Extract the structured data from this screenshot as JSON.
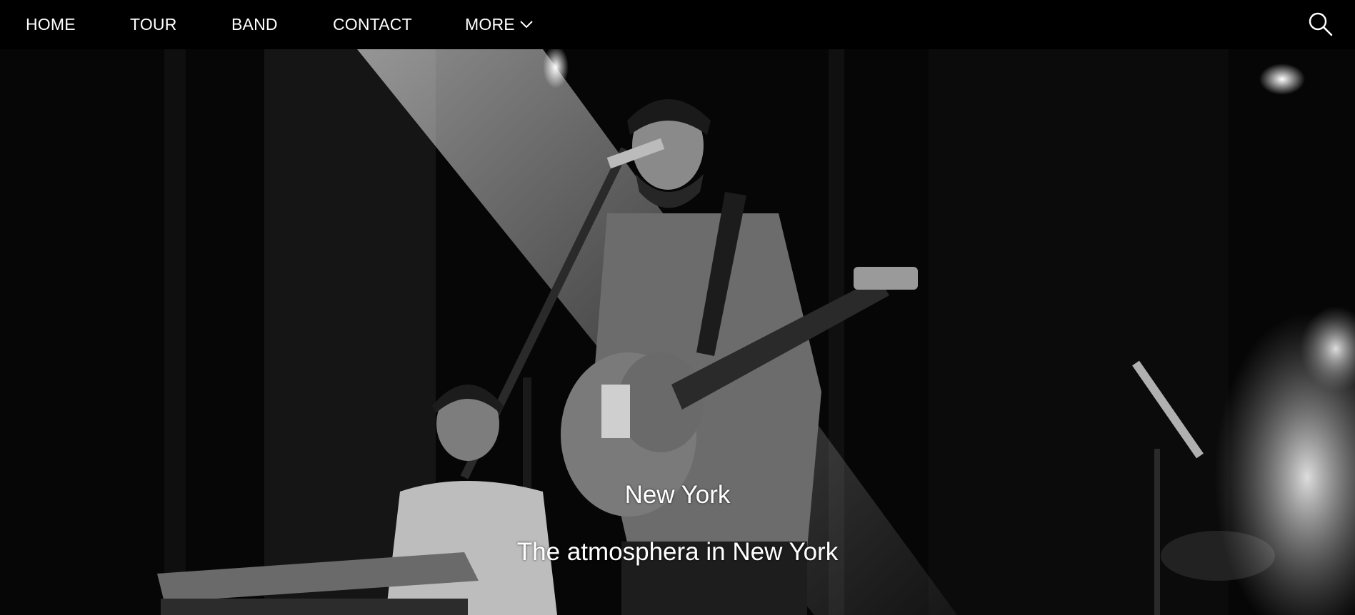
{
  "nav": {
    "items": [
      {
        "label": "HOME"
      },
      {
        "label": "TOUR"
      },
      {
        "label": "BAND"
      },
      {
        "label": "CONTACT"
      }
    ],
    "more_label": "MORE",
    "more_icon": "chevron-down-icon",
    "search_icon": "search-icon"
  },
  "slide": {
    "title": "New York",
    "text": "The atmosphera in New York"
  },
  "colors": {
    "navbar_bg": "#000000",
    "nav_text": "#ffffff",
    "hero_tone": "grayscale"
  }
}
